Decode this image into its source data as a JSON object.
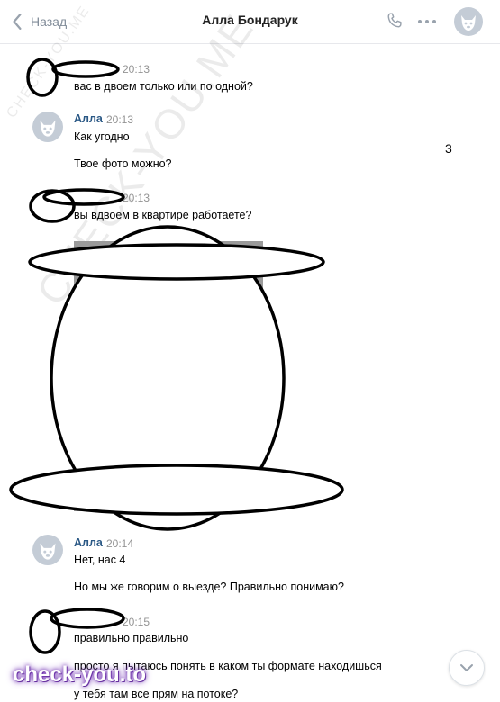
{
  "header": {
    "back_label": "Назад",
    "title": "Алла Бондарук"
  },
  "watermarks": {
    "small": "CHECK-YOU.ME",
    "large": "CHECK-YOU.ME",
    "badge": "check-you.to"
  },
  "side_number": "3",
  "messages": [
    {
      "time": "20:13",
      "text": "вас в двоем только или по одной?"
    },
    {
      "sender": "Алла",
      "time": "20:13",
      "lines": [
        "Как угодно",
        "Твое фото можно?"
      ]
    },
    {
      "time": "20:13",
      "text": "вы вдвоем в квартире работаете?"
    },
    {
      "sender": "Алла",
      "time": "20:14",
      "lines": [
        "Нет, нас 4",
        "Но мы же говорим о выезде? Правильно понимаю?"
      ]
    },
    {
      "time": "20:15",
      "lines": [
        "правильно правильно",
        "просто я пытаюсь понять в каком ты формате находишься",
        "у тебя там все прям на потоке?"
      ]
    }
  ],
  "colors": {
    "sender_name": "#2a5885",
    "time": "#939393",
    "icon": "#99a2ad"
  },
  "icons": [
    "chevron-left-icon",
    "phone-icon",
    "more-icon",
    "avatar-dog-icon",
    "chevron-down-icon"
  ]
}
